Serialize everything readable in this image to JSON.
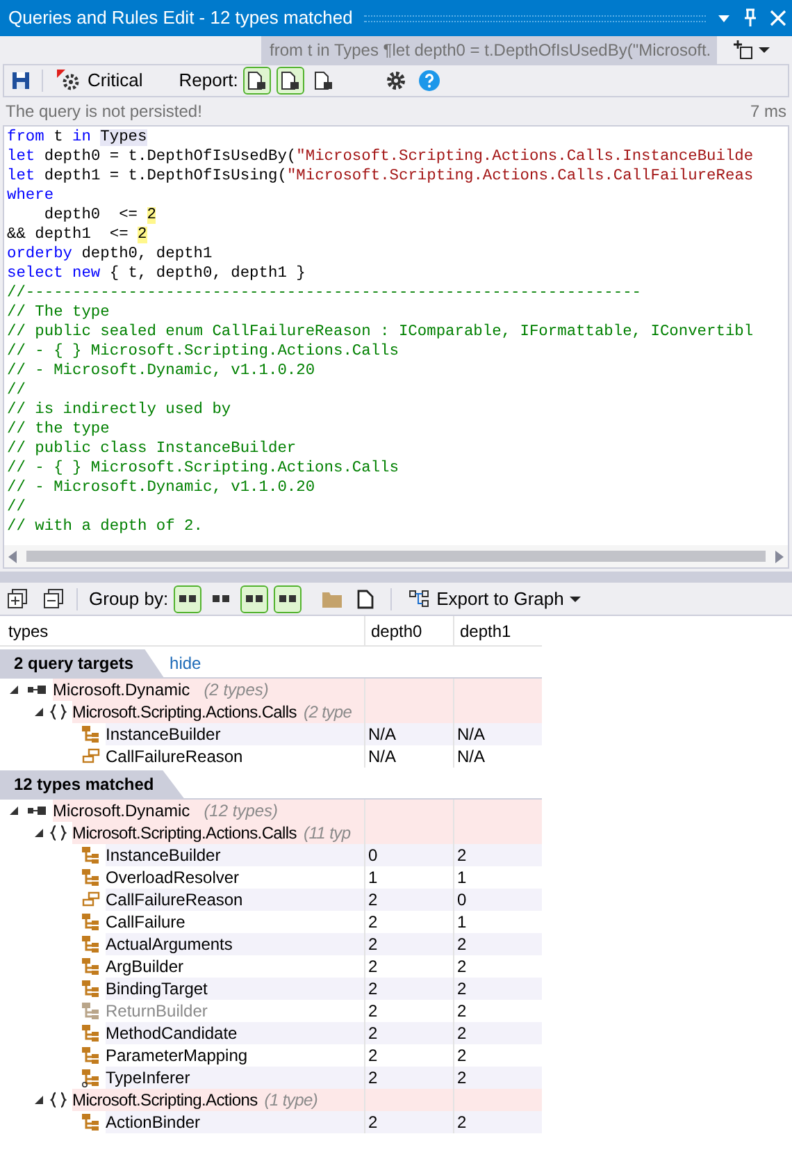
{
  "window": {
    "title": "Queries and Rules Edit  - 12 types matched"
  },
  "query_summary": "from t in Types ¶let depth0 = t.DepthOfIsUsedBy(\"Microsoft.",
  "toolbar": {
    "critical_label": "Critical",
    "report_label": "Report:",
    "report_buttons": [
      {
        "selected": true
      },
      {
        "selected": true
      },
      {
        "selected": false
      }
    ]
  },
  "status": {
    "message": "The query is not persisted!",
    "time": "7 ms"
  },
  "code_lines": [
    [
      {
        "kind": "keyword",
        "text": "from"
      },
      {
        "kind": "plain",
        "text": " t "
      },
      {
        "kind": "keyword",
        "text": "in"
      },
      {
        "kind": "highlight",
        "text": "Types"
      }
    ],
    [
      {
        "kind": "keyword",
        "text": "let"
      },
      {
        "kind": "plain",
        "text": " depth0 = t.DepthOfIsUsedBy("
      },
      {
        "kind": "string",
        "text": "\"Microsoft.Scripting.Actions.Calls.InstanceBuilde"
      }
    ],
    [
      {
        "kind": "keyword",
        "text": "let"
      },
      {
        "kind": "plain",
        "text": " depth1 = t.DepthOfIsUsing("
      },
      {
        "kind": "string",
        "text": "\"Microsoft.Scripting.Actions.Calls.CallFailureReas"
      }
    ],
    [
      {
        "kind": "keyword",
        "text": "where"
      }
    ],
    [
      {
        "kind": "plain",
        "text": "    depth0  <= "
      },
      {
        "kind": "number",
        "text": "2"
      }
    ],
    [
      {
        "kind": "plain",
        "text": "&& depth1  <= "
      },
      {
        "kind": "number",
        "text": "2"
      }
    ],
    [
      {
        "kind": "keyword",
        "text": "orderby"
      },
      {
        "kind": "plain",
        "text": " depth0, depth1"
      }
    ],
    [
      {
        "kind": "keyword",
        "text": "select new"
      },
      {
        "kind": "plain",
        "text": " { t, depth0, depth1 }"
      }
    ],
    [
      {
        "kind": "comment",
        "text": "//------------------------------------------------------------------"
      }
    ],
    [
      {
        "kind": "comment",
        "text": "// The type"
      }
    ],
    [
      {
        "kind": "comment",
        "text": "// public sealed enum CallFailureReason : IComparable, IFormattable, IConvertibl"
      }
    ],
    [
      {
        "kind": "comment",
        "text": "// - { } Microsoft.Scripting.Actions.Calls"
      }
    ],
    [
      {
        "kind": "comment",
        "text": "// - Microsoft.Dynamic, v1.1.0.20"
      }
    ],
    [
      {
        "kind": "comment",
        "text": "//"
      }
    ],
    [
      {
        "kind": "comment",
        "text": "// is indirectly used by"
      }
    ],
    [
      {
        "kind": "comment",
        "text": "// the type"
      }
    ],
    [
      {
        "kind": "comment",
        "text": "// public class InstanceBuilder"
      }
    ],
    [
      {
        "kind": "comment",
        "text": "// - { } Microsoft.Scripting.Actions.Calls"
      }
    ],
    [
      {
        "kind": "comment",
        "text": "// - Microsoft.Dynamic, v1.1.0.20"
      }
    ],
    [
      {
        "kind": "comment",
        "text": "//"
      }
    ],
    [
      {
        "kind": "comment",
        "text": "// with a depth of 2."
      }
    ]
  ],
  "results_toolbar": {
    "group_by_label": "Group by:",
    "group_by_buttons": [
      {
        "selected": true
      },
      {
        "selected": false
      },
      {
        "selected": true
      },
      {
        "selected": true
      }
    ],
    "export_label": "Export to Graph"
  },
  "table": {
    "columns": [
      "types",
      "depth0",
      "depth1"
    ],
    "sections": [
      {
        "title": "2 query targets",
        "link": "hide",
        "assemblies": [
          {
            "name": "Microsoft.Dynamic",
            "count": "(2 types)",
            "expanded": true,
            "namespaces": [
              {
                "name": "Microsoft.Scripting.Actions.Calls",
                "count": "(2 type",
                "expanded": true,
                "types": [
                  {
                    "name": "InstanceBuilder",
                    "kind": "class",
                    "dimmed": false,
                    "depth0": "N/A",
                    "depth1": "N/A"
                  },
                  {
                    "name": "CallFailureReason",
                    "kind": "enum",
                    "dimmed": false,
                    "depth0": "N/A",
                    "depth1": "N/A"
                  }
                ]
              }
            ]
          }
        ]
      },
      {
        "title": "12 types matched",
        "assemblies": [
          {
            "name": "Microsoft.Dynamic",
            "count": "(12 types)",
            "expanded": true,
            "namespaces": [
              {
                "name": "Microsoft.Scripting.Actions.Calls",
                "count": "(11 typ",
                "expanded": true,
                "types": [
                  {
                    "name": "InstanceBuilder",
                    "kind": "class",
                    "dimmed": false,
                    "depth0": "0",
                    "depth1": "2"
                  },
                  {
                    "name": "OverloadResolver",
                    "kind": "class",
                    "dimmed": false,
                    "depth0": "1",
                    "depth1": "1"
                  },
                  {
                    "name": "CallFailureReason",
                    "kind": "enum",
                    "dimmed": false,
                    "depth0": "2",
                    "depth1": "0"
                  },
                  {
                    "name": "CallFailure",
                    "kind": "class",
                    "dimmed": false,
                    "depth0": "2",
                    "depth1": "1"
                  },
                  {
                    "name": "ActualArguments",
                    "kind": "class",
                    "dimmed": false,
                    "depth0": "2",
                    "depth1": "2"
                  },
                  {
                    "name": "ArgBuilder",
                    "kind": "class",
                    "dimmed": false,
                    "depth0": "2",
                    "depth1": "2"
                  },
                  {
                    "name": "BindingTarget",
                    "kind": "class",
                    "dimmed": false,
                    "depth0": "2",
                    "depth1": "2"
                  },
                  {
                    "name": "ReturnBuilder",
                    "kind": "class",
                    "dimmed": true,
                    "depth0": "2",
                    "depth1": "2"
                  },
                  {
                    "name": "MethodCandidate",
                    "kind": "class",
                    "dimmed": false,
                    "depth0": "2",
                    "depth1": "2"
                  },
                  {
                    "name": "ParameterMapping",
                    "kind": "class",
                    "dimmed": false,
                    "depth0": "2",
                    "depth1": "2"
                  },
                  {
                    "name": "TypeInferer",
                    "kind": "static-class",
                    "dimmed": false,
                    "depth0": "2",
                    "depth1": "2"
                  }
                ]
              },
              {
                "name": "Microsoft.Scripting.Actions",
                "count": "(1 type)",
                "expanded": true,
                "types": [
                  {
                    "name": "ActionBinder",
                    "kind": "class",
                    "dimmed": false,
                    "depth0": "2",
                    "depth1": "2"
                  }
                ]
              }
            ]
          }
        ]
      }
    ]
  }
}
